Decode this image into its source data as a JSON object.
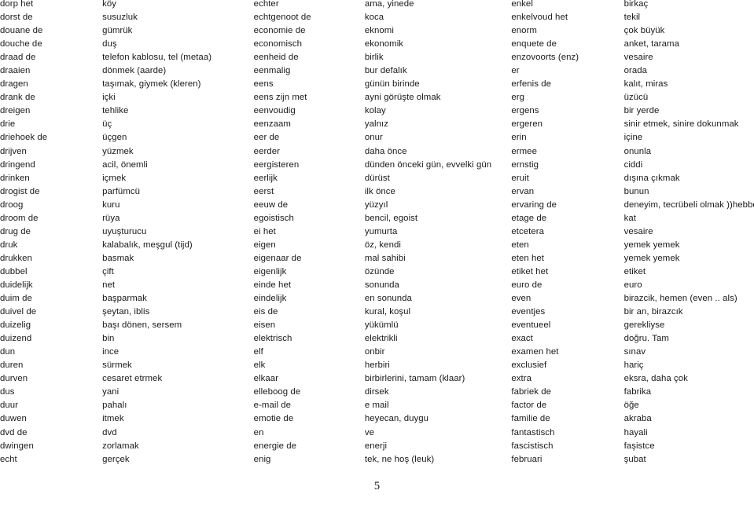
{
  "document": {
    "type": "dictionary-glossary",
    "page_number": "5",
    "column_count": 6,
    "pair_groups": 3
  },
  "entries": [
    [
      "dorp het",
      "köy",
      "echter",
      "ama, yinede",
      "enkel",
      "birkaç"
    ],
    [
      "dorst de",
      "susuzluk",
      "echtgenoot de",
      "koca",
      "enkelvoud het",
      "tekil"
    ],
    [
      "douane de",
      "gümrük",
      "economie de",
      "eknomi",
      "enorm",
      "çok büyük"
    ],
    [
      "douche de",
      "duş",
      "economisch",
      "ekonomik",
      "enquete de",
      "anket, tarama"
    ],
    [
      "draad de",
      "telefon kablosu, tel (metaa)",
      "eenheid de",
      "birlik",
      "enzovoorts (enz)",
      "vesaire"
    ],
    [
      "draaien",
      "dönmek (aarde)",
      "eenmalig",
      "bur defalık",
      "er",
      "orada"
    ],
    [
      "dragen",
      "taşımak, giymek (kleren)",
      "eens",
      "günün birinde",
      "erfenis de",
      "kalıt, miras"
    ],
    [
      "drank de",
      "içki",
      "eens zijn met",
      "ayni görüşte olmak",
      "erg",
      "üzücü"
    ],
    [
      "dreigen",
      "tehlike",
      "eenvoudig",
      "kolay",
      "ergens",
      "bir yerde"
    ],
    [
      "drie",
      "üç",
      "eenzaam",
      "yalnız",
      "ergeren",
      "sinir etmek, sinire dokunmak"
    ],
    [
      "driehoek de",
      "üçgen",
      "eer de",
      "onur",
      "erin",
      "içine"
    ],
    [
      "drijven",
      "yüzmek",
      "eerder",
      "daha önce",
      "ermee",
      "onunla"
    ],
    [
      "dringend",
      "acil, önemli",
      "eergisteren",
      "dünden önceki gün, evvelki gün",
      "ernstig",
      "ciddi"
    ],
    [
      "drinken",
      "içmek",
      "eerlijk",
      "dürüst",
      "eruit",
      "dışına çıkmak"
    ],
    [
      "drogist de",
      "parfümcü",
      "eerst",
      "ilk önce",
      "ervan",
      "bunun"
    ],
    [
      "droog",
      "kuru",
      "eeuw de",
      "yüzyıl",
      "ervaring de",
      "deneyim, tecrübeli olmak ))hebben)"
    ],
    [
      "droom de",
      "rüya",
      "egoistisch",
      "bencil, egoist",
      "etage de",
      "kat"
    ],
    [
      "drug de",
      "uyuşturucu",
      "ei het",
      "yumurta",
      "etcetera",
      "vesaire"
    ],
    [
      "druk",
      "kalabalık, meşgul (tijd)",
      "eigen",
      "öz, kendi",
      "eten",
      "yemek yemek"
    ],
    [
      "drukken",
      "basmak",
      "eigenaar de",
      "mal sahibi",
      "eten het",
      "yemek yemek"
    ],
    [
      "dubbel",
      "çift",
      "eigenlijk",
      "özünde",
      "etiket het",
      "etiket"
    ],
    [
      "duidelijk",
      "net",
      "einde het",
      "sonunda",
      "euro de",
      "euro"
    ],
    [
      "duim de",
      "başparmak",
      "eindelijk",
      "en sonunda",
      "even",
      "birazcik, hemen (even .. als)"
    ],
    [
      "duivel de",
      "şeytan, iblis",
      "eis de",
      "kural, koşul",
      "eventjes",
      "bir  an, birazcık"
    ],
    [
      "duizelig",
      "başı dönen, sersem",
      "eisen",
      "yükümlü",
      "eventueel",
      "gerekliyse"
    ],
    [
      "duizend",
      "bin",
      "elektrisch",
      "elektrikli",
      "exact",
      "doğru. Tam"
    ],
    [
      "dun",
      "ince",
      "elf",
      "onbir",
      "examen het",
      "sınav"
    ],
    [
      "duren",
      "sürmek",
      "elk",
      "herbiri",
      "exclusief",
      "hariç"
    ],
    [
      "durven",
      "cesaret etrmek",
      "elkaar",
      "birbirlerini, tamam (klaar)",
      "extra",
      "eksra, daha çok"
    ],
    [
      "dus",
      "yani",
      "elleboog de",
      "dirsek",
      "fabriek de",
      "fabrika"
    ],
    [
      "duur",
      "pahalı",
      "e-mail de",
      "e mail",
      "factor de",
      "öğe"
    ],
    [
      "duwen",
      "itmek",
      "emotie de",
      "heyecan, duygu",
      "familie de",
      "akraba"
    ],
    [
      "dvd de",
      "dvd",
      "en",
      "ve",
      "fantastisch",
      "hayali"
    ],
    [
      "dwingen",
      "zorlamak",
      "energie de",
      "enerji",
      "fascistisch",
      "faşistce"
    ],
    [
      "echt",
      "gerçek",
      "enig",
      "tek, ne hoş (leuk)",
      "februari",
      "şubat"
    ]
  ]
}
